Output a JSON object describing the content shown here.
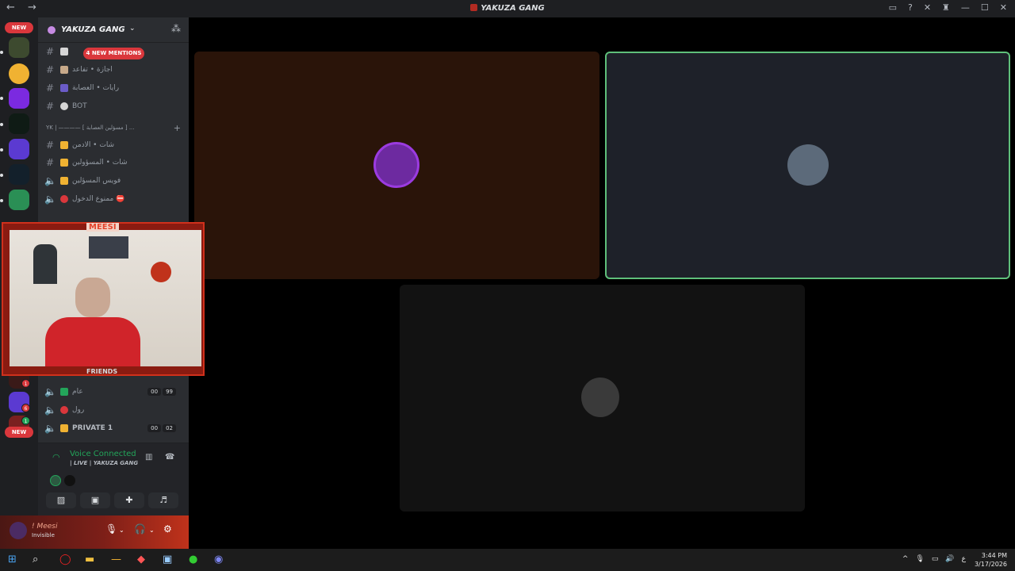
{
  "window": {
    "title": "YAKUZA GANG",
    "nav_icons": "← →",
    "controls": [
      "inbox-icon",
      "help-icon",
      "tools-icon",
      "bug-icon",
      "minimize-icon",
      "maximize-icon",
      "close-icon"
    ]
  },
  "rail": {
    "new_badge_top": "NEW",
    "new_badge_bottom": "NEW",
    "counts": [
      "1",
      "6",
      "1"
    ],
    "servers_colors": [
      "#3d4a2f",
      "#f0b232",
      "#7b2ae0",
      "#0f1b15",
      "#5b3ad1",
      "#13202b",
      "#2a8f55",
      "#3a1a18"
    ]
  },
  "guild": {
    "name": "YAKUZA GANG",
    "mentions": "4 NEW MENTIONS",
    "channels": [
      {
        "type": "text",
        "emoji_color": "#d6d6d6",
        "label": ""
      },
      {
        "type": "text",
        "emoji_color": "#c7a98a",
        "label": "اجازة • تفاعد"
      },
      {
        "type": "text",
        "emoji_color": "#6b5cc8",
        "label": "رايات • العصابة"
      },
      {
        "type": "text",
        "emoji_color": "#d6d6d6",
        "label": "BOT"
      },
      {
        "type": "text",
        "emoji_color": "#f0b232",
        "label": "شات • الادمن"
      },
      {
        "type": "text",
        "emoji_color": "#f0b232",
        "label": "شات • المسؤولين"
      },
      {
        "type": "voice",
        "emoji_color": "#f0b232",
        "label": "فويس المسؤلين"
      },
      {
        "type": "voice",
        "emoji_color": "#da373c",
        "label": "ممنوع الدخول ⛔"
      }
    ],
    "category": "YK | ———— [ مسؤلين العصابة ] ...",
    "voice_channels": [
      {
        "label": "عام",
        "emoji_color": "#23a55a",
        "nums": [
          "00",
          "99"
        ]
      },
      {
        "label": "رول",
        "emoji_color": "#da373c",
        "nums": []
      },
      {
        "label": "PRIVATE 1",
        "emoji_color": "#f0b232",
        "nums": [
          "00",
          "02"
        ]
      }
    ]
  },
  "voice_panel": {
    "status": "Voice Connected",
    "channel": "| LIVE | YAKUZA GANG",
    "buttons": [
      "camera-off-icon",
      "screen-share-icon",
      "activities-icon",
      "soundboard-icon"
    ]
  },
  "user": {
    "name": "! Meesi",
    "status": "Invisible"
  },
  "webcam": {
    "name": "MEESI",
    "caption": "FRIENDS"
  },
  "tiles": [
    {
      "bg": "#2a1409",
      "border": "#2a1409",
      "avatar": "#6d2aa0"
    },
    {
      "bg": "#1e2129",
      "border": "#5fbf7a",
      "avatar": "#5c6a7a"
    },
    {
      "bg": "#121212",
      "border": "#121212",
      "avatar": "#3a3a3a"
    }
  ],
  "taskbar": {
    "time": "3:44 PM",
    "date": "3/17/2026",
    "lang": "ع"
  }
}
